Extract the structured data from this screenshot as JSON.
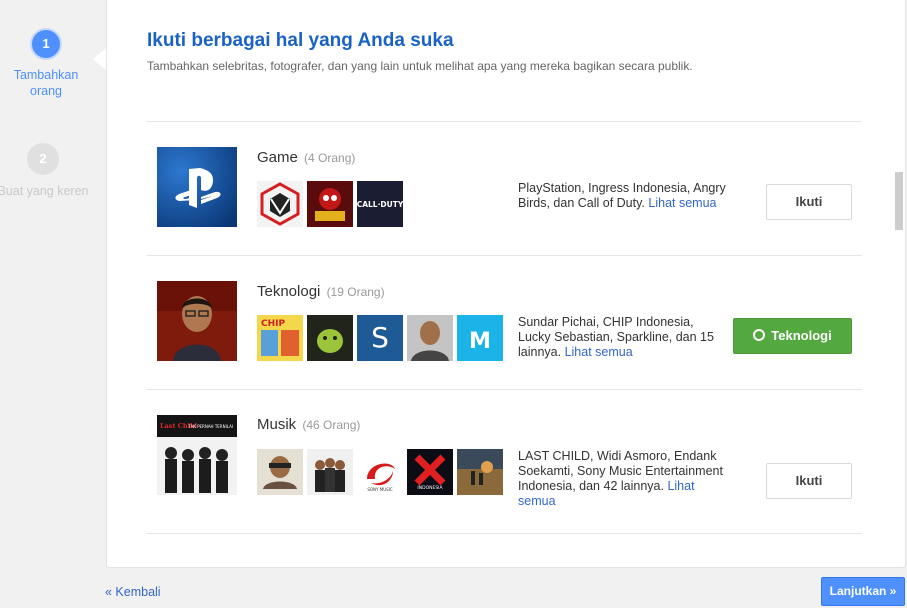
{
  "stepper": {
    "steps": [
      {
        "number": "1",
        "label": "Tambahkan orang"
      },
      {
        "number": "2",
        "label": "Buat yang keren"
      }
    ]
  },
  "page": {
    "title": "Ikuti berbagai hal yang Anda suka",
    "subtitle": "Tambahkan selebritas, fotografer, dan yang lain untuk melihat apa yang mereka bagikan secara publik."
  },
  "categories": [
    {
      "name": "Game",
      "count": "(4 Orang)",
      "desc": "PlayStation, Ingress Indonesia, Angry Birds, dan Call of Duty.",
      "link": "Lihat semua",
      "button": "Ikuti",
      "followed": false,
      "thumbs": [
        "ingress-logo",
        "angry-birds-star-wars",
        "call-of-duty-logo"
      ]
    },
    {
      "name": "Teknologi",
      "count": "(19 Orang)",
      "desc": "Sundar Pichai, CHIP Indonesia, Lucky Sebastian, Sparkline, dan 15 lainnya.",
      "link": "Lihat semua",
      "button": "Teknologi",
      "followed": true,
      "thumbs": [
        "chip-magazine",
        "android-photo",
        "s-logo",
        "person-photo",
        "m-logo"
      ]
    },
    {
      "name": "Musik",
      "count": "(46 Orang)",
      "desc": "LAST CHILD, Widi Asmoro, Endank Soekamti, Sony Music Entertainment Indonesia, dan 42 lainnya.",
      "link": "Lihat semua",
      "button": "Ikuti",
      "followed": false,
      "thumbs": [
        "artist-photo",
        "band-photo",
        "sony-music-logo",
        "x-factor-logo",
        "landscape-photo"
      ]
    }
  ],
  "thumb_text": {
    "playstation": "PlayStation",
    "call_of_duty": "CALL·DUTY",
    "chip": "CHIP",
    "s": "S",
    "m": "M",
    "sony": "SONY MUSIC",
    "xfactor": "X FACTOR",
    "indonesia": "INDONESIA",
    "musik_cover_left": "Last Child",
    "musik_cover_right": "TAK PERNAH TERNILAI"
  },
  "footer": {
    "back": "« Kembali",
    "next": "Lanjutkan »"
  },
  "colors": {
    "accent": "#4d90fe",
    "link": "#3366cc",
    "followed": "#53a93f",
    "title": "#1a62c6"
  }
}
